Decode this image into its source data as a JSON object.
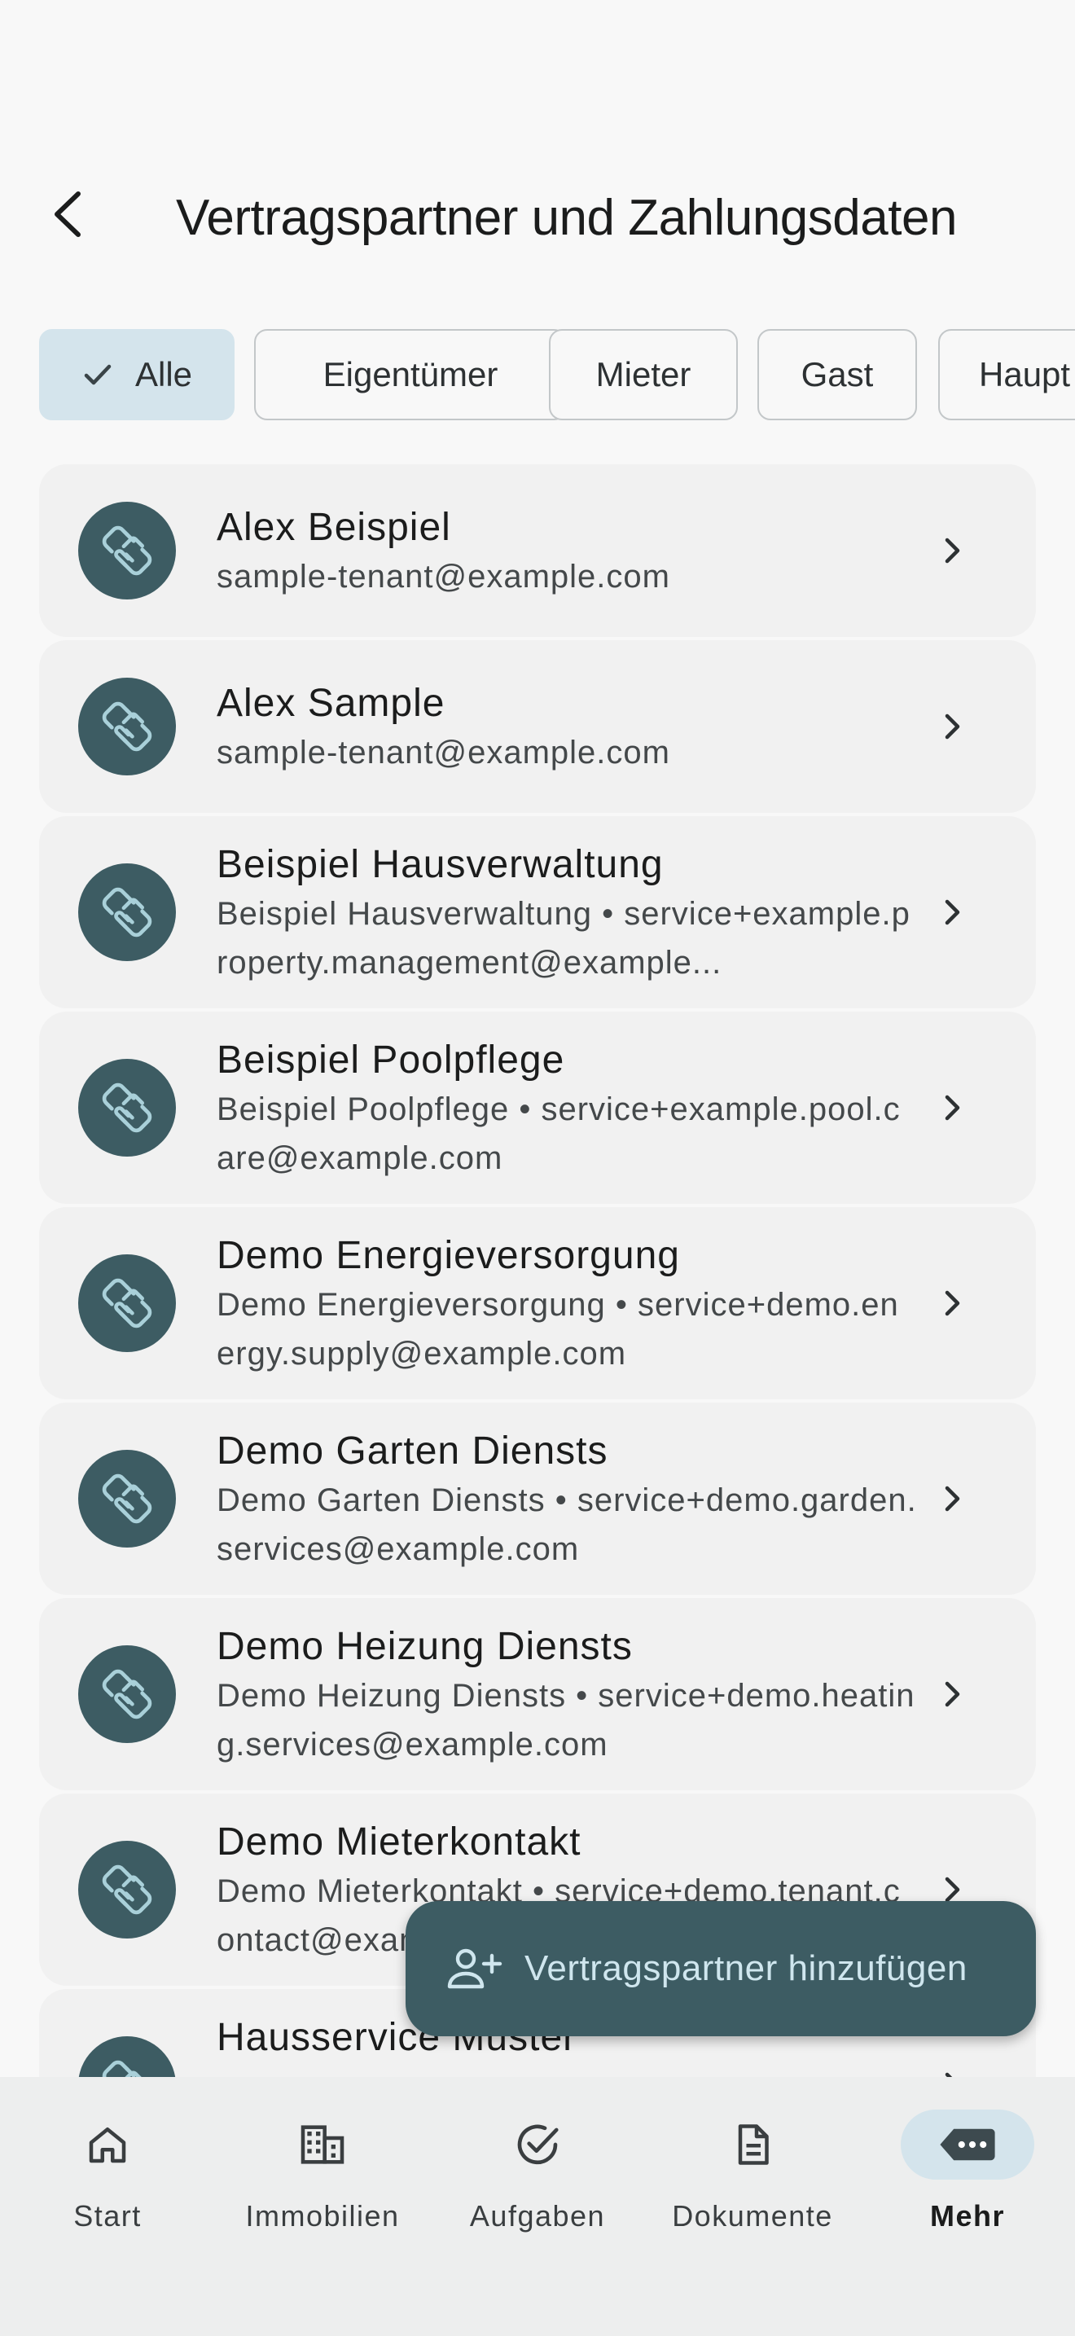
{
  "header": {
    "title": "Vertragspartner und Zahlungsdaten"
  },
  "filters": [
    {
      "label": "Alle",
      "selected": true
    },
    {
      "label": "Eigentümer",
      "selected": false
    },
    {
      "label": "Mieter",
      "selected": false
    },
    {
      "label": "Gast",
      "selected": false
    },
    {
      "label": "Haupt",
      "selected": false
    }
  ],
  "partners": [
    {
      "name": "Alex Beispiel",
      "detail": "sample-tenant@example.com"
    },
    {
      "name": "Alex Sample",
      "detail": "sample-tenant@example.com"
    },
    {
      "name": "Beispiel Hausverwaltung",
      "detail": "Beispiel Hausverwaltung • service+example.property.management@example..."
    },
    {
      "name": "Beispiel Poolpflege",
      "detail": "Beispiel Poolpflege • service+example.pool.care@example.com"
    },
    {
      "name": "Demo Energieversorgung",
      "detail": "Demo Energieversorgung • service+demo.energy.supply@example.com"
    },
    {
      "name": "Demo Garten Diensts",
      "detail": "Demo Garten Diensts • service+demo.garden.services@example.com"
    },
    {
      "name": "Demo Heizung Diensts",
      "detail": "Demo Heizung Diensts • service+demo.heating.services@example.com"
    },
    {
      "name": "Demo Mieterkontakt",
      "detail": "Demo Mieterkontakt • service+demo.tenant.contact@example.com"
    },
    {
      "name": "Hausservice Muster",
      "detail": ""
    }
  ],
  "fab": {
    "label": "Vertragspartner hinzufügen"
  },
  "nav": [
    {
      "label": "Start",
      "icon": "home-icon"
    },
    {
      "label": "Immobilien",
      "icon": "building-icon"
    },
    {
      "label": "Aufgaben",
      "icon": "check-circle-icon"
    },
    {
      "label": "Dokumente",
      "icon": "document-icon"
    },
    {
      "label": "Mehr",
      "icon": "more-icon",
      "active": true
    }
  ],
  "colors": {
    "accent": "#3d5c63",
    "chip_selected": "#d4e4ec",
    "card": "#f1f1f1",
    "background": "#f8f8f8"
  }
}
